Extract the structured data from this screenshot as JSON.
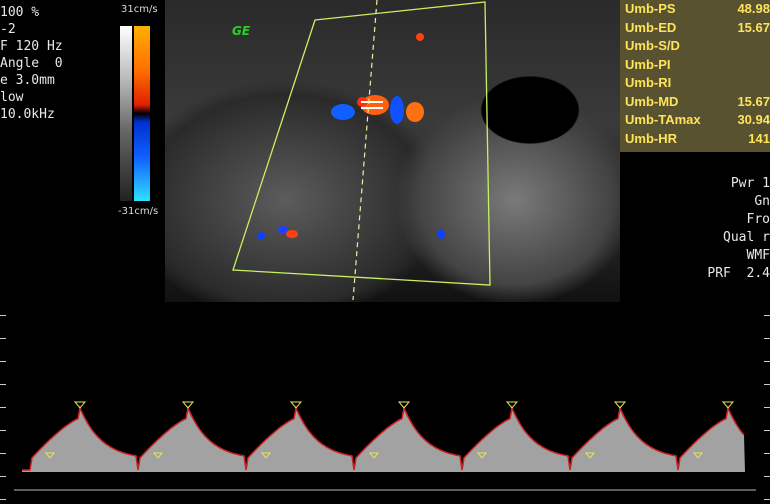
{
  "left_params": [
    "100 %",
    "-2",
    "F 120 Hz",
    "Angle  0",
    "e 3.0mm",
    "low",
    "10.0kHz"
  ],
  "colorbar": {
    "top_label": "31cm/s",
    "bottom_label": "-31cm/s"
  },
  "brand": {
    "logo_text": "GE",
    "logo_color": "#2ad02a"
  },
  "measurements": [
    {
      "label": "Umb-PS",
      "value": "48.98"
    },
    {
      "label": "Umb-ED",
      "value": "15.67"
    },
    {
      "label": "Umb-S/D",
      "value": ""
    },
    {
      "label": "Umb-PI",
      "value": ""
    },
    {
      "label": "Umb-RI",
      "value": ""
    },
    {
      "label": "Umb-MD",
      "value": "15.67"
    },
    {
      "label": "Umb-TAmax",
      "value": "30.94"
    },
    {
      "label": "Umb-HR",
      "value": "141"
    }
  ],
  "right_params": [
    "Pwr 1",
    "Gn",
    "Fro",
    "Qual r",
    "WMF",
    "PRF  2.4"
  ],
  "spectral": {
    "trace_color": "#cc2020",
    "marker_color": "#e8e850"
  },
  "colors": {
    "measurement_box": "#585230",
    "measurement_text": "#ffe45a",
    "sector_outline": "#c8f060"
  }
}
